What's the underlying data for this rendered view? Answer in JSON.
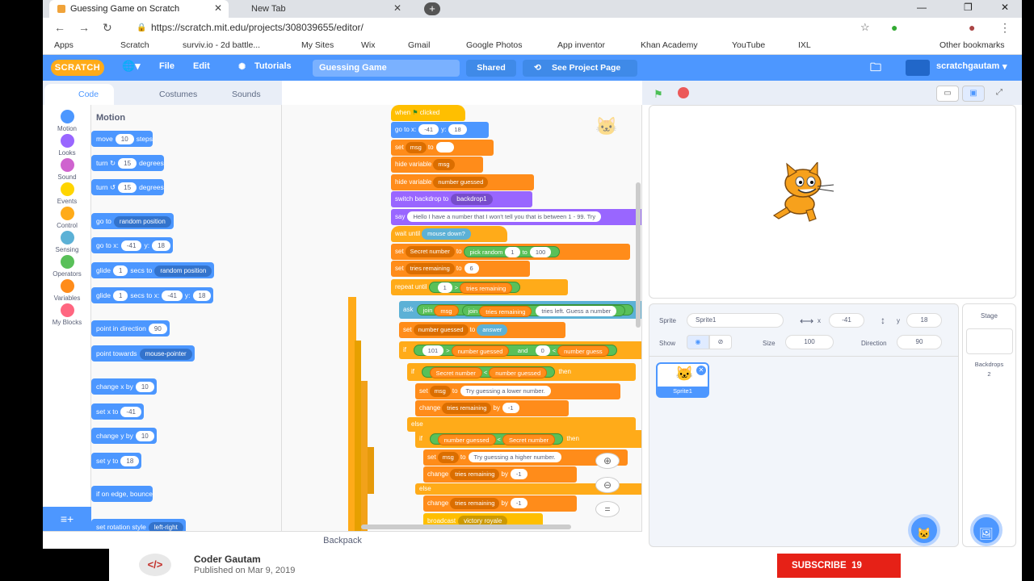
{
  "browser": {
    "tabs": [
      {
        "label": "Guessing Game on Scratch",
        "active": true
      },
      {
        "label": "New Tab",
        "active": false
      }
    ],
    "url": "https://scratch.mit.edu/projects/308039655/editor/",
    "bookmarks": [
      "Apps",
      "Scratch",
      "surviv.io - 2d battle...",
      "My Sites",
      "Wix",
      "Gmail",
      "Google Photos",
      "App inventor",
      "Khan Academy",
      "YouTube",
      "IXL",
      "Other bookmarks"
    ]
  },
  "menubar": {
    "logo": "SCRATCH",
    "file": "File",
    "edit": "Edit",
    "tutorials": "Tutorials",
    "project_title": "Guessing Game",
    "shared": "Shared",
    "see_project": "See Project Page",
    "username": "scratchgautam"
  },
  "editor_tabs": {
    "code": "Code",
    "costumes": "Costumes",
    "sounds": "Sounds"
  },
  "categories": [
    {
      "label": "Motion",
      "color": "#4c97ff"
    },
    {
      "label": "Looks",
      "color": "#9966ff"
    },
    {
      "label": "Sound",
      "color": "#cf63cf"
    },
    {
      "label": "Events",
      "color": "#ffd500"
    },
    {
      "label": "Control",
      "color": "#ffab19"
    },
    {
      "label": "Sensing",
      "color": "#5cb1d6"
    },
    {
      "label": "Operators",
      "color": "#59c059"
    },
    {
      "label": "Variables",
      "color": "#ff8c1a"
    },
    {
      "label": "My Blocks",
      "color": "#ff6680"
    }
  ],
  "palette": {
    "title": "Motion",
    "move": {
      "pre": "move",
      "val": "10",
      "post": "steps"
    },
    "turn_right": {
      "pre": "turn",
      "val": "15",
      "post": "degrees"
    },
    "turn_left": {
      "pre": "turn",
      "val": "15",
      "post": "degrees"
    },
    "goto": {
      "pre": "go to",
      "dd": "random position"
    },
    "gotoxy": {
      "pre": "go to x:",
      "x": "-41",
      "mid": "y:",
      "y": "18"
    },
    "glide1": {
      "pre": "glide",
      "val": "1",
      "mid": "secs to",
      "dd": "random position"
    },
    "glide2": {
      "pre": "glide",
      "val": "1",
      "mid": "secs to x:",
      "x": "-41",
      "ymid": "y:",
      "y": "18"
    },
    "point_dir": {
      "pre": "point in direction",
      "val": "90"
    },
    "point_towards": {
      "pre": "point towards",
      "dd": "mouse-pointer"
    },
    "change_x": {
      "pre": "change x by",
      "val": "10"
    },
    "set_x": {
      "pre": "set x to",
      "val": "-41"
    },
    "change_y": {
      "pre": "change y by",
      "val": "10"
    },
    "set_y": {
      "pre": "set y to",
      "val": "18"
    },
    "bounce": {
      "pre": "if on edge, bounce"
    },
    "rotation": {
      "pre": "set rotation style",
      "dd": "left-right"
    }
  },
  "script": {
    "when_flag": {
      "pre": "when",
      "post": "clicked"
    },
    "gotoxy": {
      "pre": "go to x:",
      "x": "-41",
      "mid": "y:",
      "y": "18"
    },
    "set_msg": {
      "pre": "set",
      "var": "msg",
      "mid": "to"
    },
    "hide_msg": {
      "pre": "hide variable",
      "var": "msg"
    },
    "hide_ng": {
      "pre": "hide variable",
      "var": "number guessed"
    },
    "backdrop": {
      "pre": "switch backdrop to",
      "dd": "backdrop1"
    },
    "say": {
      "pre": "say",
      "text": "Hello  I have a number that I won't tell you that is between 1 - 99.  Try"
    },
    "wait_until": {
      "pre": "wait until",
      "cond": "mouse down?"
    },
    "set_secret": {
      "pre": "set",
      "var": "Secret number",
      "mid": "to",
      "op": "pick random",
      "a": "1",
      "b": "to",
      "c": "100"
    },
    "set_tries": {
      "pre": "set",
      "var": "tries remaining",
      "mid": "to",
      "val": "6"
    },
    "repeat_until": {
      "pre": "repeat until",
      "a": "1",
      "op": ">",
      "b": "tries remaining"
    },
    "ask": {
      "pre": "ask",
      "join1": "join",
      "v1": "msg",
      "join2": "join",
      "v2": "tries remaining",
      "text": "tries left.  Guess a number"
    },
    "set_ng": {
      "pre": "set",
      "var": "number guessed",
      "mid": "to",
      "val": "answer"
    },
    "if1": {
      "pre": "if",
      "a": "101",
      "op": ">",
      "b": "number guessed",
      "and": "and",
      "c": "0",
      "op2": "<",
      "d": "number guess"
    },
    "if2": {
      "pre": "if",
      "a": "Secret number",
      "op": "<",
      "b": "number guessed",
      "then": "then"
    },
    "set_lower": {
      "pre": "set",
      "var": "msg",
      "mid": "to",
      "text": "Try guessing a lower number."
    },
    "change1": {
      "pre": "change",
      "var": "tries remaining",
      "mid": "by",
      "val": "-1"
    },
    "else1": "else",
    "if3": {
      "pre": "if",
      "a": "number guessed",
      "op": "<",
      "b": "Secret number",
      "then": "then"
    },
    "set_higher": {
      "pre": "set",
      "var": "msg",
      "mid": "to",
      "text": "Try guessing a higher number."
    },
    "change2": {
      "pre": "change",
      "var": "tries remaining",
      "mid": "by",
      "val": "-1"
    },
    "else2": "else",
    "change3": {
      "pre": "change",
      "var": "tries remaining",
      "mid": "by",
      "val": "-1"
    },
    "broadcast": {
      "pre": "broadcast",
      "dd": "victory royale"
    }
  },
  "backpack": "Backpack",
  "sprite_info": {
    "sprite_label": "Sprite",
    "sprite_name": "Sprite1",
    "x_label": "x",
    "x": "-41",
    "y_label": "y",
    "y": "18",
    "show_label": "Show",
    "size_label": "Size",
    "size": "100",
    "direction_label": "Direction",
    "direction": "90",
    "thumb_name": "Sprite1"
  },
  "stage_panel": {
    "title": "Stage",
    "backdrops_label": "Backdrops",
    "backdrops_count": "2"
  },
  "video": {
    "channel": "Coder Gautam",
    "published": "Published on Mar 9, 2019",
    "subscribe": "SUBSCRIBE",
    "subscriber_count": "19"
  }
}
